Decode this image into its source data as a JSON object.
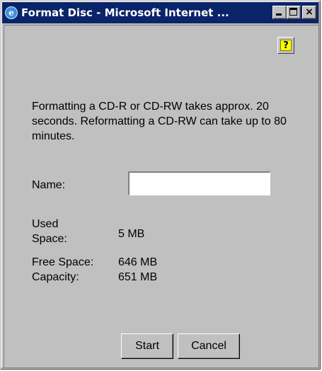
{
  "window": {
    "title": "Format Disc - Microsoft Internet ...",
    "icon": "internet-explorer-icon",
    "controls": {
      "minimize": "minimize-icon",
      "maximize": "maximize-icon",
      "close_glyph": "×"
    }
  },
  "help": {
    "glyph": "?",
    "icon": "help-icon"
  },
  "dialog": {
    "intro": "Formatting a CD-R or CD-RW takes approx. 20 seconds. Reformatting a CD-RW can take up to 80 minutes.",
    "name_label": "Name:",
    "name_value": "",
    "used_space_label": "Used Space:",
    "used_space_value": "5 MB",
    "free_space_label": "Free Space:",
    "free_space_value": "646 MB",
    "capacity_label": "Capacity:",
    "capacity_value": "651 MB"
  },
  "buttons": {
    "start": "Start",
    "cancel": "Cancel"
  },
  "colors": {
    "titlebar": "#0a246a",
    "face": "#c0c0c0",
    "help_icon": "#ffff00"
  }
}
